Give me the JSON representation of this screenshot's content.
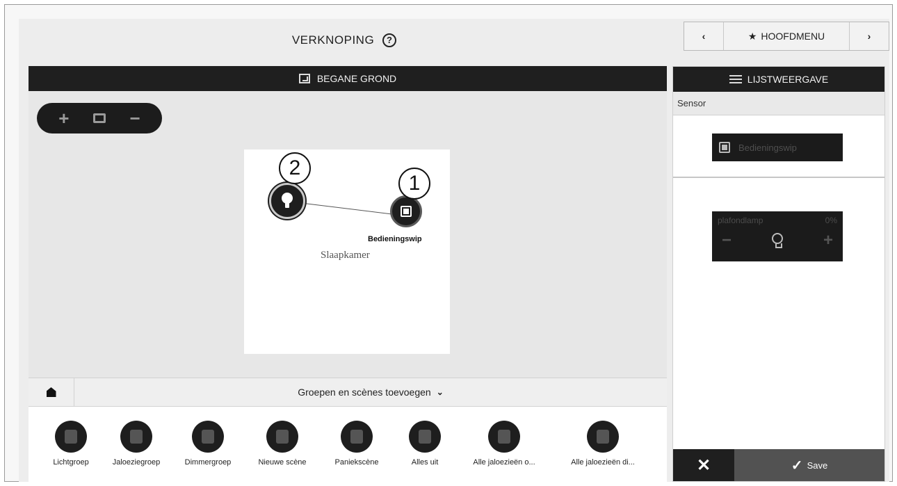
{
  "header": {
    "title": "VERKNOPING",
    "help_icon": "?"
  },
  "nav": {
    "prev": "‹",
    "main": "HOOFDMENU",
    "next": "›"
  },
  "floorplan": {
    "title": "BEGANE GROND",
    "zoom": {
      "in": "+",
      "out": "−"
    },
    "room_name": "Slaapkamer",
    "device_label": "Bedieningswip",
    "callouts": [
      "2",
      "1"
    ]
  },
  "groups_bar": {
    "label": "Groepen en scènes toevoegen"
  },
  "tray": [
    {
      "label": "Lichtgroep"
    },
    {
      "label": "Jaloeziegroep"
    },
    {
      "label": "Dimmergroep"
    },
    {
      "label": "Nieuwe scène"
    },
    {
      "label": "Paniekscène"
    },
    {
      "label": "Alles uit"
    },
    {
      "label": "Alle jaloezieën o..."
    },
    {
      "label": "Alle jaloezieën di..."
    }
  ],
  "list_view": {
    "title": "LIJSTWEERGAVE",
    "sensor_heading": "Sensor",
    "sensor_button": "Bedieningswip",
    "actor": {
      "name": "plafondlamp",
      "value": "0%",
      "minus": "−",
      "plus": "+"
    }
  },
  "footer": {
    "cancel": "✕",
    "save": "Save",
    "save_check": "✓"
  }
}
